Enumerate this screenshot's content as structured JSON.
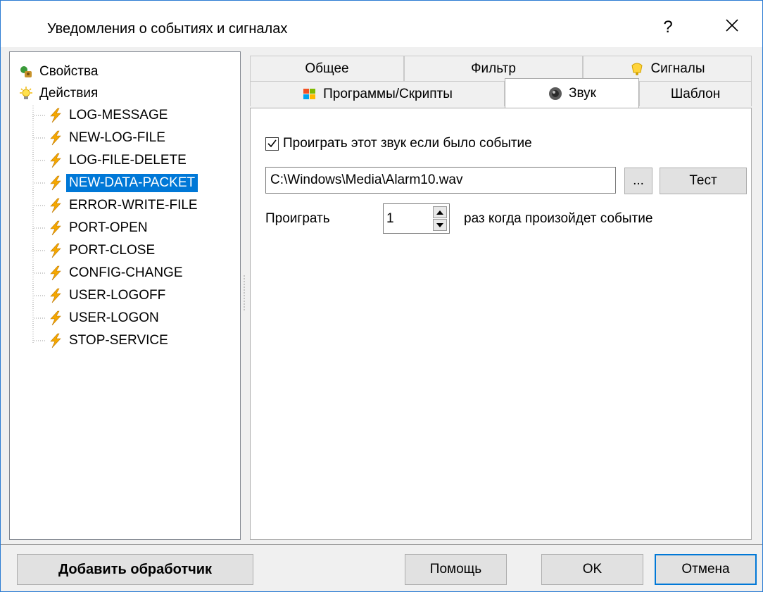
{
  "window": {
    "title": "Уведомления о событиях и сигналах",
    "help": "?",
    "close_icon": "close-icon"
  },
  "tree": {
    "properties_label": "Свойства",
    "actions_label": "Действия",
    "items": [
      "LOG-MESSAGE",
      "NEW-LOG-FILE",
      "LOG-FILE-DELETE",
      "NEW-DATA-PACKET",
      "ERROR-WRITE-FILE",
      "PORT-OPEN",
      "PORT-CLOSE",
      "CONFIG-CHANGE",
      "USER-LOGOFF",
      "USER-LOGON",
      "STOP-SERVICE"
    ],
    "selected_item": "NEW-DATA-PACKET"
  },
  "tabs": {
    "row1": [
      "Общее",
      "Фильтр",
      "Сигналы"
    ],
    "row2": [
      "Программы/Скрипты",
      "Звук",
      "Шаблон"
    ],
    "active": "Звук"
  },
  "sound": {
    "checkbox_label": "Проиграть этот звук если было событие",
    "checked": true,
    "file_path": "C:\\Windows\\Media\\Alarm10.wav",
    "browse_label": "...",
    "test_label": "Тест",
    "play_label": "Проиграть",
    "play_count": "1",
    "after_label": "раз когда произойдет событие"
  },
  "footer": {
    "add_handler": "Добавить обработчик",
    "help": "Помощь",
    "ok": "OK",
    "cancel": "Отмена"
  },
  "colors": {
    "selection": "#0078d7",
    "border": "#2b7bd3",
    "lightning": "#f6a800"
  }
}
